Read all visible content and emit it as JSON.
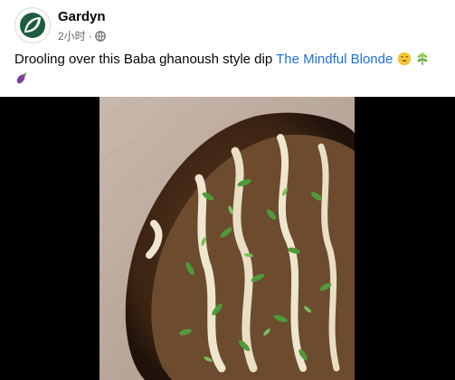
{
  "post": {
    "author": "Gardyn",
    "time": "2小时",
    "separator": "·",
    "text_prefix": "Drooling over this Baba ghanoush style dip ",
    "link_text": "The Mindful Blonde",
    "emojis": [
      "drooling-face",
      "herb",
      "eggplant"
    ]
  },
  "colors": {
    "brand": "#1d5c3e",
    "link": "#216fdb",
    "meta": "#65676b"
  }
}
